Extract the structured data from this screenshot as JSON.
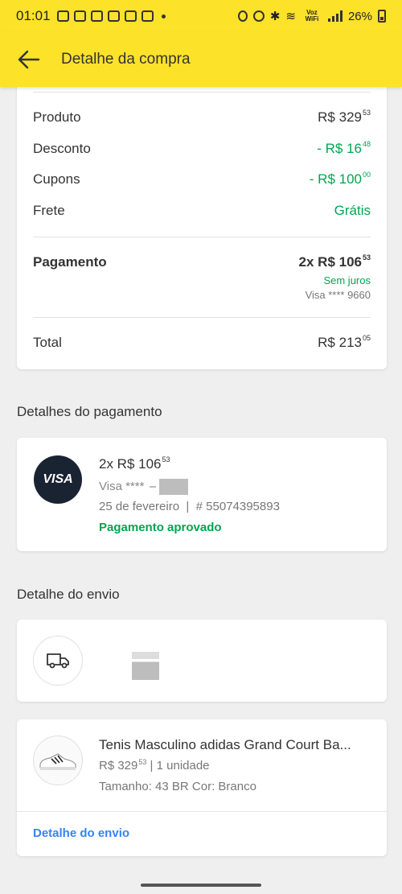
{
  "status_bar": {
    "time": "01:01",
    "battery": "26%",
    "network_label": "Voz WiFi"
  },
  "app_bar": {
    "title": "Detalhe da compra",
    "back_icon": "arrow-left-icon"
  },
  "summary": {
    "rows": [
      {
        "label": "Produto",
        "value_main": "R$ 329",
        "value_cents": "53",
        "color": "#333333"
      },
      {
        "label": "Desconto",
        "value_main": "- R$ 16",
        "value_cents": "48",
        "color": "#00a650"
      },
      {
        "label": "Cupons",
        "value_main": "- R$ 100",
        "value_cents": "00",
        "color": "#00a650"
      },
      {
        "label": "Frete",
        "value_main": "Grátis",
        "value_cents": "",
        "color": "#00a650"
      }
    ],
    "payment": {
      "label": "Pagamento",
      "amount_main": "2x R$ 106",
      "amount_cents": "53",
      "interest": "Sem juros",
      "card": "Visa **** 9660"
    },
    "total": {
      "label": "Total",
      "value_main": "R$ 213",
      "value_cents": "05"
    }
  },
  "payment_details": {
    "section_title": "Detalhes do pagamento",
    "badge": "VISA",
    "amount_main": "2x R$ 106",
    "amount_cents": "53",
    "card_visible": "Visa **** ",
    "date": "25 de fevereiro",
    "operation": "# 55074395893",
    "status": "Pagamento aprovado"
  },
  "shipping": {
    "section_title": "Detalhe do envio",
    "icon": "truck-icon"
  },
  "product": {
    "name": "Tenis Masculino adidas Grand Court Ba...",
    "price_main": "R$ 329",
    "price_cents": "53",
    "quantity": "1 unidade",
    "attributes": "Tamanho: 43 BR Cor: Branco",
    "link": "Detalhe do envio"
  },
  "colors": {
    "brand_yellow": "#fde22a",
    "green": "#00a650",
    "link_blue": "#3483fa"
  }
}
